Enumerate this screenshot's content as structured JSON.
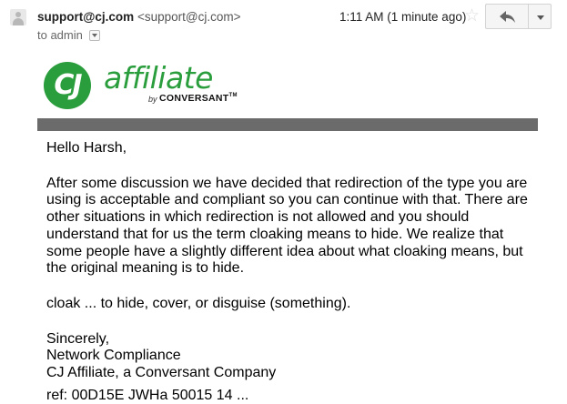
{
  "header": {
    "sender_name": "support@cj.com",
    "sender_email": "<support@cj.com>",
    "to_label": "to admin",
    "timestamp": "1:11 AM (1 minute ago)",
    "icons": {
      "avatar": "person-avatar-icon",
      "star": "star-icon",
      "reply": "reply-arrow-icon",
      "more": "chevron-down-icon"
    }
  },
  "logo": {
    "mark": "CJ",
    "word": "affiliate",
    "by": "by",
    "brand": "CONVERSANT",
    "tm": "TM",
    "colors": {
      "green": "#2a9d3c",
      "bar": "#6b6b6b"
    }
  },
  "body": {
    "greeting": "Hello Harsh,",
    "paragraph": "After some discussion we have decided that redirection of the type you are using is acceptable and compliant so you can continue with that. There are other situations in which redirection is not allowed and you should understand that for us the term cloaking means to hide. We realize that some people have a slightly different idea about what cloaking means, but the original meaning is to hide.",
    "definition": "cloak ... to hide, cover, or disguise (something).",
    "signoff": "Sincerely,",
    "team": "Network Compliance",
    "company": "CJ Affiliate, a Conversant Company",
    "cut_off_line": "ref: 00D15E JWHa 50015 14 ..."
  }
}
